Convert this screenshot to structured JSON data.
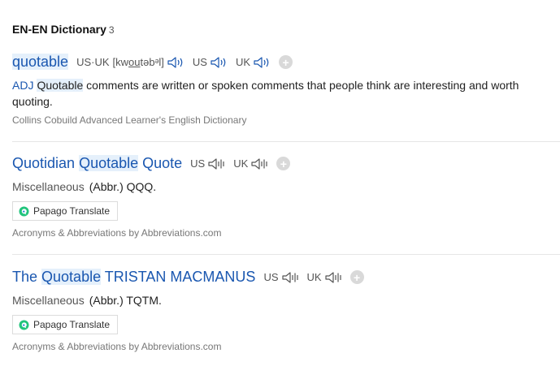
{
  "header": {
    "title": "EN-EN Dictionary",
    "count": "3"
  },
  "entries": [
    {
      "word": "quotable",
      "pron": {
        "dialect_label": "US·UK",
        "ipa_open": "[kw",
        "ipa_underlined": "ou",
        "ipa_close": "təbᵊl]",
        "us": "US",
        "uk": "UK"
      },
      "definition": {
        "pos": "ADJ",
        "highlight": "Quotable",
        "text": " comments are written or spoken comments that people think are interesting and worth quoting."
      },
      "source": "Collins Cobuild Advanced Learner's English Dictionary"
    },
    {
      "word_pre": "Quotidian ",
      "word_highlight": "Quotable",
      "word_post": " Quote",
      "pron": {
        "us": "US",
        "uk": "UK"
      },
      "category": "Miscellaneous",
      "abbr": "(Abbr.) QQQ.",
      "translate_label": "Papago Translate",
      "source": "Acronyms & Abbreviations by Abbreviations.com"
    },
    {
      "word_pre": "The ",
      "word_highlight": "Quotable",
      "word_post": " TRISTAN MACMANUS",
      "pron": {
        "us": "US",
        "uk": "UK"
      },
      "category": "Miscellaneous",
      "abbr": "(Abbr.) TQTM.",
      "translate_label": "Papago Translate",
      "source": "Acronyms & Abbreviations by Abbreviations.com"
    }
  ]
}
